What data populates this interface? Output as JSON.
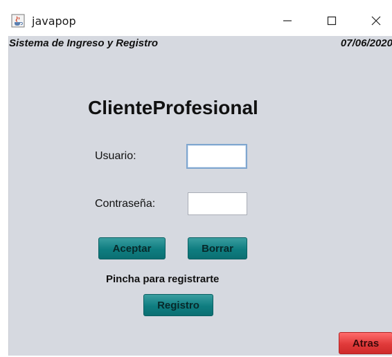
{
  "window": {
    "title": "javapop",
    "icons": {
      "app": "java-cup-icon",
      "minimize": "minimize-icon",
      "maximize": "maximize-icon",
      "close": "close-icon"
    }
  },
  "header": {
    "system_title": "Sistema de Ingreso y Registro",
    "date": "07/06/2020"
  },
  "form": {
    "title": "ClienteProfesional",
    "user_label": "Usuario:",
    "user_value": "",
    "password_label": "Contraseña:",
    "password_value": "",
    "accept_label": "Aceptar",
    "clear_label": "Borrar",
    "register_hint": "Pincha para registrarte",
    "register_label": "Registro",
    "back_label": "Atras"
  },
  "colors": {
    "panel_background": "#d6d9e0",
    "button_teal": "#0f7d80",
    "button_red": "#e03a3a"
  }
}
